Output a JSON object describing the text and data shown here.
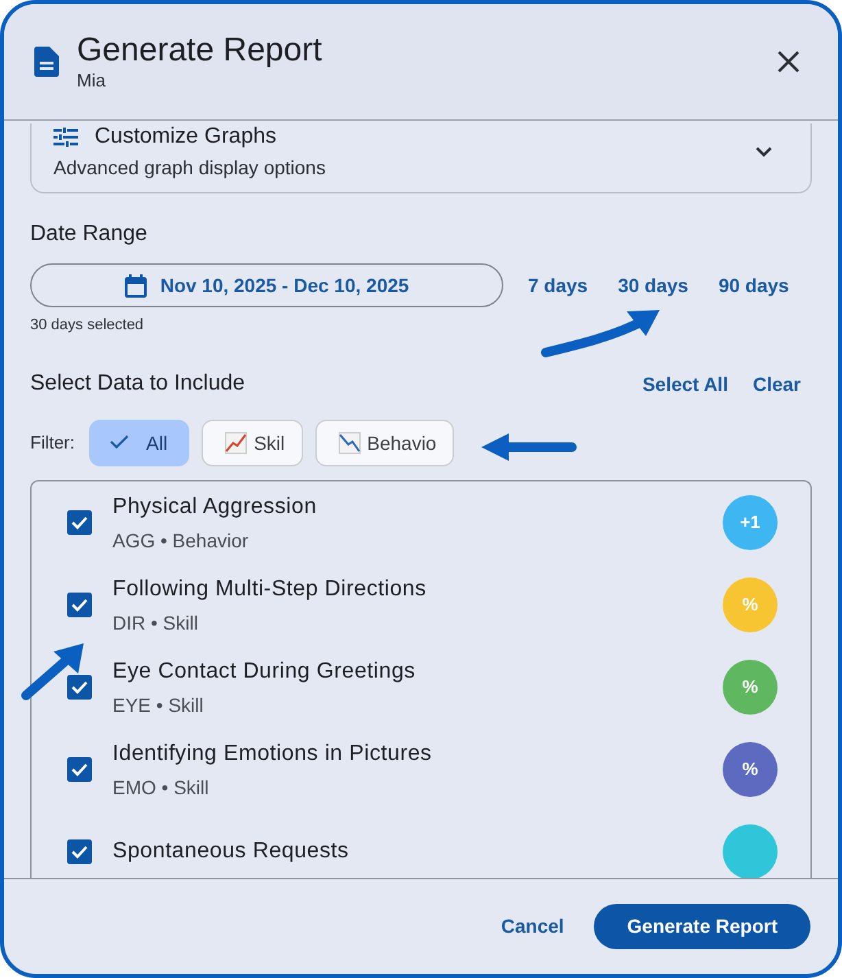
{
  "dialog": {
    "title": "Generate Report",
    "subtitle": "Mia"
  },
  "graph_options": {
    "title": "Customize Graphs",
    "description": "Advanced graph display options",
    "expanded": false
  },
  "date_range": {
    "label": "Date Range",
    "value": "Nov 10, 2025 - Dec 10, 2025",
    "helper": "30 days selected",
    "presets": [
      {
        "label": "7 days"
      },
      {
        "label": "30 days"
      },
      {
        "label": "90 days"
      }
    ]
  },
  "data_section": {
    "title": "Select Data to Include",
    "actions": [
      "Select All",
      "Clear"
    ],
    "filter_label": "Filter:",
    "filters": [
      {
        "label": "All",
        "kind": "check",
        "selected": true
      },
      {
        "label": "Skil",
        "kind": "up",
        "selected": false
      },
      {
        "label": "Behavio",
        "kind": "down",
        "selected": false
      }
    ],
    "items": [
      {
        "name": "Physical Aggression",
        "meta": "AGG • Behavior",
        "checked": true,
        "badge": "+1",
        "color": "#3db6f2"
      },
      {
        "name": "Following Multi-Step Directions",
        "meta": "DIR • Skill",
        "checked": true,
        "badge": "%",
        "color": "#f7c531"
      },
      {
        "name": "Eye Contact During Greetings",
        "meta": "EYE • Skill",
        "checked": true,
        "badge": "%",
        "color": "#5fb760"
      },
      {
        "name": "Identifying Emotions in Pictures",
        "meta": "EMO • Skill",
        "checked": true,
        "badge": "%",
        "color": "#5c6bc0"
      },
      {
        "name": "Spontaneous Requests",
        "checked": true,
        "color": "#2ec6d8"
      }
    ]
  },
  "buttons": [
    {
      "label": "Cancel",
      "kind": "text"
    },
    {
      "label": "Generate Report",
      "kind": "primary"
    }
  ]
}
